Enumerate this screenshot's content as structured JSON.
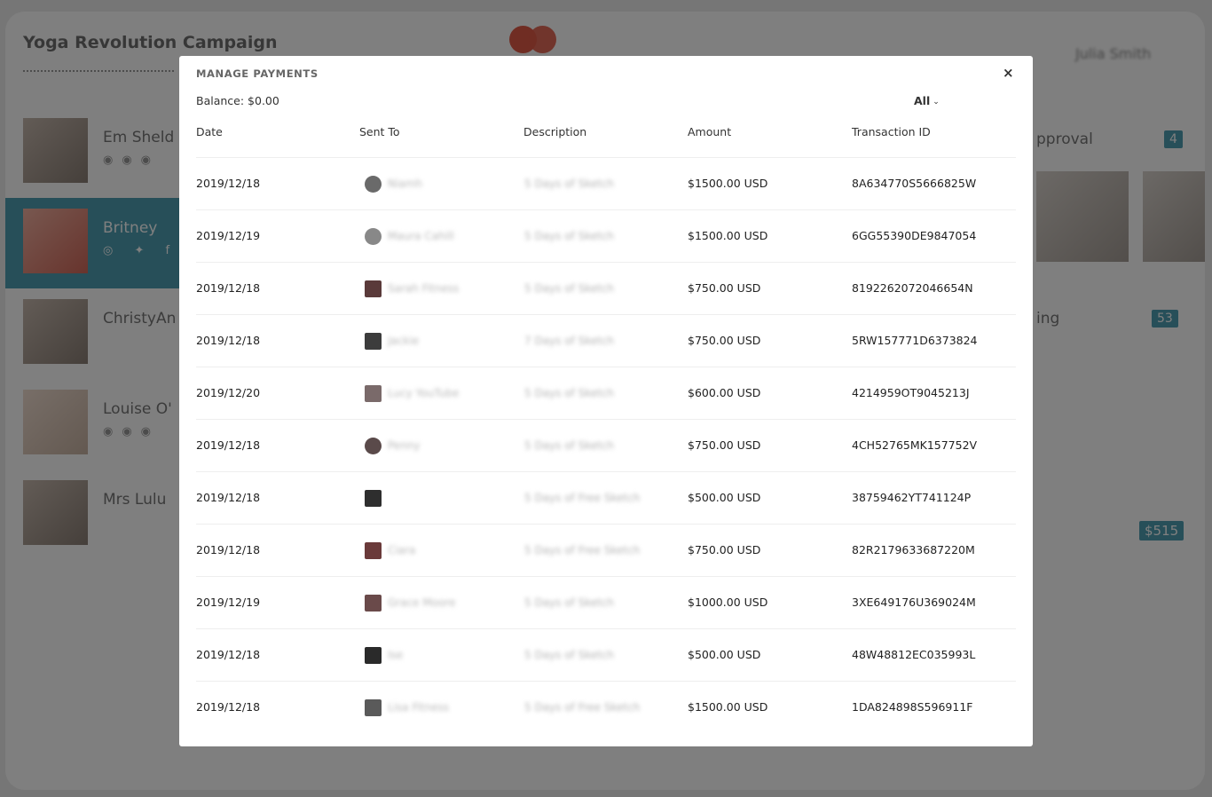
{
  "background": {
    "campaign_title": "Yoga Revolution Campaign",
    "user_name": "Julia Smith",
    "influencers": [
      {
        "name": "Em Sheld"
      },
      {
        "name": "Britney"
      },
      {
        "name": "ChristyAn"
      },
      {
        "name": "Louise O'"
      },
      {
        "name": "Mrs Lulu"
      }
    ],
    "approval_label": "pproval",
    "approval_count": "4",
    "pending_label": "ing",
    "pending_count": "53",
    "amount_badge": "$515"
  },
  "modal": {
    "title": "MANAGE PAYMENTS",
    "close_symbol": "×",
    "balance": "Balance: $0.00",
    "filter_value": "All",
    "columns": {
      "date": "Date",
      "sent_to": "Sent To",
      "description": "Description",
      "amount": "Amount",
      "transaction_id": "Transaction ID"
    },
    "rows": [
      {
        "date": "2019/12/18",
        "sent_to": "Niamh",
        "description": "5 Days of Sketch",
        "amount": "$1500.00 USD",
        "transaction_id": "8A634770S5666825W"
      },
      {
        "date": "2019/12/19",
        "sent_to": "Maura Cahill",
        "description": "5 Days of Sketch",
        "amount": "$1500.00 USD",
        "transaction_id": "6GG55390DE9847054"
      },
      {
        "date": "2019/12/18",
        "sent_to": "Sarah Fitness",
        "description": "5 Days of Sketch",
        "amount": "$750.00 USD",
        "transaction_id": "8192262072046654N"
      },
      {
        "date": "2019/12/18",
        "sent_to": "Jackie",
        "description": "7 Days of Sketch",
        "amount": "$750.00 USD",
        "transaction_id": "5RW157771D6373824"
      },
      {
        "date": "2019/12/20",
        "sent_to": "Lucy YouTube",
        "description": "5 Days of Sketch",
        "amount": "$600.00 USD",
        "transaction_id": "4214959OT9045213J"
      },
      {
        "date": "2019/12/18",
        "sent_to": "Penny",
        "description": "5 Days of Sketch",
        "amount": "$750.00 USD",
        "transaction_id": "4CH52765MK157752V"
      },
      {
        "date": "2019/12/18",
        "sent_to": "",
        "description": "5 Days of Free Sketch",
        "amount": "$500.00 USD",
        "transaction_id": "38759462YT741124P"
      },
      {
        "date": "2019/12/18",
        "sent_to": "Ciara",
        "description": "5 Days of Free Sketch",
        "amount": "$750.00 USD",
        "transaction_id": "82R2179633687220M"
      },
      {
        "date": "2019/12/19",
        "sent_to": "Grace Moore",
        "description": "5 Days of Sketch",
        "amount": "$1000.00 USD",
        "transaction_id": "3XE649176U369024M"
      },
      {
        "date": "2019/12/18",
        "sent_to": "Ise",
        "description": "5 Days of Sketch",
        "amount": "$500.00 USD",
        "transaction_id": "48W48812EC035993L"
      },
      {
        "date": "2019/12/18",
        "sent_to": "Lisa Fitness",
        "description": "5 Days of Free Sketch",
        "amount": "$1500.00 USD",
        "transaction_id": "1DA824898S596911F"
      }
    ]
  },
  "colors": {
    "accent": "#4f9fb2",
    "logo": "#e05a47",
    "overlay": "rgba(0,0,0,0.5)"
  }
}
